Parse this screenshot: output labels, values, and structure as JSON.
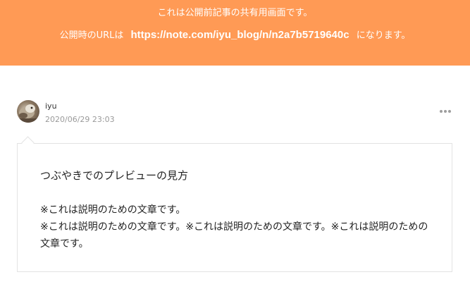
{
  "banner": {
    "line1": "これは公開前記事の共有用画面です。",
    "line2_prefix": "公開時のURLは",
    "url": "https://note.com/iyu_blog/n/n2a7b5719640c",
    "line2_suffix": "になります。",
    "background_color": "#ff9a55"
  },
  "post": {
    "author_name": "iyu",
    "date": "2020/06/29 23:03",
    "more_icon": "more-horizontal-icon",
    "title": "つぶやきでのプレビューの見方",
    "body": [
      "※これは説明のための文章です。",
      "※これは説明のための文章です。※これは説明のための文章です。※これは説明のための文章です。"
    ]
  }
}
